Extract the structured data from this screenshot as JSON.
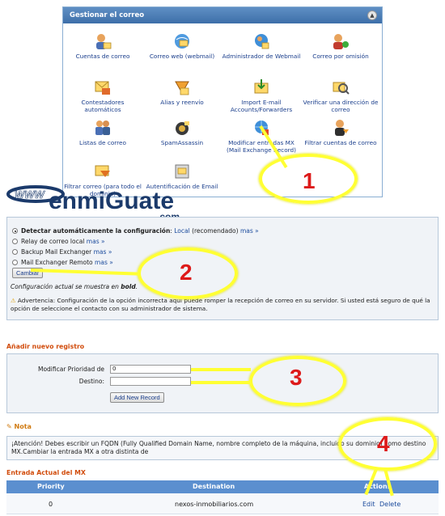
{
  "mail_panel": {
    "title": "Gestionar el correo",
    "collapse_glyph": "▲",
    "items": [
      {
        "label": "Cuentas de correo",
        "icon": "user-mail-icon"
      },
      {
        "label": "Correo web (webmail)",
        "icon": "webmail-icon"
      },
      {
        "label": "Administrador de Webmail",
        "icon": "webmail-admin-icon"
      },
      {
        "label": "Correo por omisión",
        "icon": "default-mail-icon"
      },
      {
        "label": "Contestadores automáticos",
        "icon": "autoresponder-icon"
      },
      {
        "label": "Alias y reenvío",
        "icon": "forwarder-icon"
      },
      {
        "label": "Import E-mail Accounts/Forwarders",
        "icon": "import-icon"
      },
      {
        "label": "Verificar una dirección de correo",
        "icon": "verify-icon"
      },
      {
        "label": "Listas de correo",
        "icon": "mailing-list-icon"
      },
      {
        "label": "SpamAssassin",
        "icon": "spam-icon"
      },
      {
        "label": "Modificar entradas MX (Mail Exchange Record)",
        "icon": "mx-entry-icon"
      },
      {
        "label": "Filtrar cuentas de correo",
        "icon": "account-filter-icon"
      },
      {
        "label": "Filtrar correo (para todo el dominio)",
        "icon": "domain-filter-icon"
      },
      {
        "label": "Autentificación de Email",
        "icon": "email-auth-icon"
      }
    ]
  },
  "logo": {
    "brand": "enmiGuate",
    "suffix": ".com",
    "prefix": "WWW"
  },
  "mx_config": {
    "options": [
      {
        "label": "Detectar automáticamente la configuración",
        "suffix": ": ",
        "value": "Local",
        "note": " (recomendado) ",
        "more": "mas »",
        "selected": true
      },
      {
        "label": "Relay de correo local",
        "more": "mas »",
        "selected": false
      },
      {
        "label": "Backup Mail Exchanger",
        "more": "mas »",
        "selected": false
      },
      {
        "label": "Mail Exchanger Remoto",
        "more": "mas »",
        "selected": false
      }
    ],
    "change_button": "Cambiar",
    "current_prefix": "Configuración actual se muestra en",
    "current_bold": "bold",
    "current_suffix": ".",
    "warning": "Advertencia: Configuración de la opción incorrecta aquí puede romper la recepción de correo en su servidor. Si usted está seguro de qué la opción de seleccione el contacto con su administrador de sistema."
  },
  "add_record": {
    "title": "Añadir nuevo registro",
    "priority_label": "Modificar Prioridad de",
    "priority_value": "0",
    "destination_label": "Destino:",
    "destination_value": "",
    "button": "Add New Record"
  },
  "note": {
    "title": "Nota",
    "text": "¡Atención! Debes escribir un FQDN (Fully Qualified Domain Name, nombre completo de la máquina, incluido su dominio) como destino MX.Cambiar la entrada MX a otra distinta de"
  },
  "current_mx": {
    "title": "Entrada Actual del MX",
    "headers": [
      "Priority",
      "Destination",
      "Actions"
    ],
    "rows": [
      {
        "priority": "0",
        "destination": "nexos-inmobiliarios.com",
        "edit": "Edit",
        "delete": "Delete"
      }
    ]
  },
  "annotations": [
    "1",
    "2",
    "3",
    "4"
  ],
  "colors": {
    "accent": "#5b8fcf",
    "section_title": "#d14c0c",
    "highlight": "#ffff33",
    "annotation_number": "#dd1a1a"
  }
}
